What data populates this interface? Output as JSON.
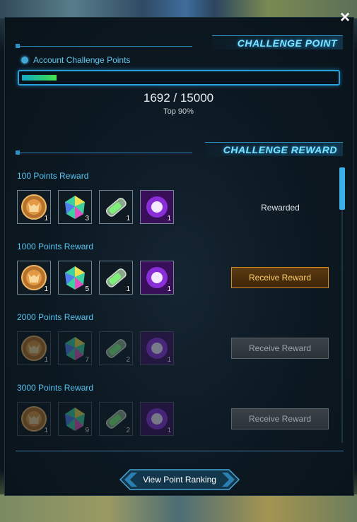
{
  "window": {
    "close_glyph": "×"
  },
  "challenge_point": {
    "title": "CHALLENGE POINT",
    "account_label": "Account Challenge Points",
    "progress": {
      "current": 1692,
      "max": 15000,
      "fraction": 0.1128
    },
    "score_text": "1692 / 15000",
    "rank_text": "Top 90%"
  },
  "challenge_reward": {
    "title": "CHALLENGE REWARD",
    "tiers": [
      {
        "label": "100 Points Reward",
        "quantities": [
          "1",
          "3",
          "1",
          "1"
        ],
        "state": "rewarded",
        "status_text": "Rewarded"
      },
      {
        "label": "1000 Points Reward",
        "quantities": [
          "1",
          "5",
          "1",
          "1"
        ],
        "state": "available",
        "button_label": "Receive Reward"
      },
      {
        "label": "2000 Points Reward",
        "quantities": [
          "1",
          "7",
          "2",
          "1"
        ],
        "state": "locked",
        "button_label": "Receive Reward"
      },
      {
        "label": "3000 Points Reward",
        "quantities": [
          "1",
          "9",
          "2",
          "1"
        ],
        "state": "locked",
        "button_label": "Receive Reward"
      }
    ],
    "item_icons": [
      "owl-medal-icon",
      "rainbow-gem-icon",
      "energy-canister-icon",
      "purple-burst-icon"
    ]
  },
  "footer": {
    "ranking_button": "View Point Ranking"
  },
  "colors": {
    "accent_cyan": "#7de4ff",
    "button_active_border": "#d68a23",
    "button_active_text": "#ffcf6a",
    "button_disabled_text": "#9aa4aa"
  }
}
